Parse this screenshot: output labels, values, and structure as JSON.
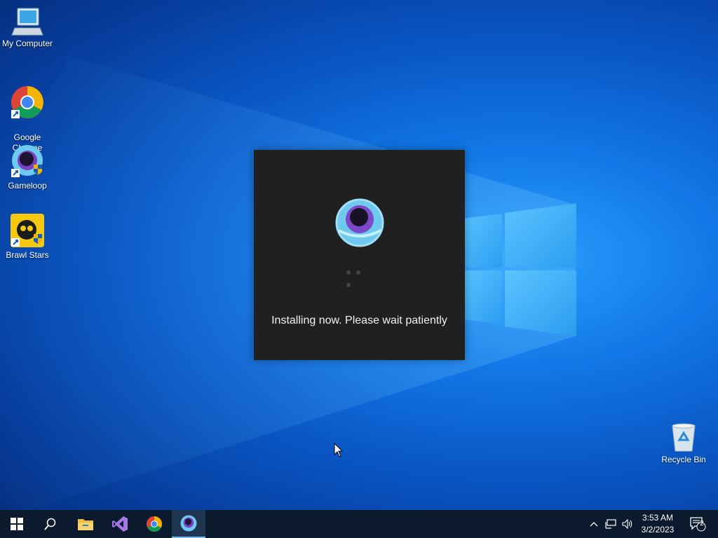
{
  "desktop_icons": [
    {
      "label": "My Computer",
      "icon": "my-computer-icon"
    },
    {
      "label": "Google\nChrome",
      "icon": "chrome-shortcut-icon"
    },
    {
      "label": "Gameloop",
      "icon": "gameloop-shortcut-icon"
    },
    {
      "label": "Brawl Stars",
      "icon": "brawl-stars-shortcut-icon"
    },
    {
      "label": "Recycle Bin",
      "icon": "recycle-bin-icon"
    }
  ],
  "installer": {
    "message": "Installing now. Please wait patiently",
    "icon": "gameloop-logo-icon"
  },
  "taskbar": {
    "buttons": [
      "start-icon",
      "search-icon",
      "file-explorer-icon",
      "visual-studio-icon",
      "chrome-icon",
      "gameloop-icon"
    ],
    "active": "gameloop-icon",
    "tray_icons": [
      "chevron-up-icon",
      "network-icon",
      "volume-icon"
    ],
    "time": "3:53 AM",
    "date": "3/2/2023",
    "notification_count": "2"
  },
  "colors": {
    "desktop_blue": "#1277e6",
    "taskbar": "#0c1a2e",
    "installer_bg": "#202021"
  }
}
